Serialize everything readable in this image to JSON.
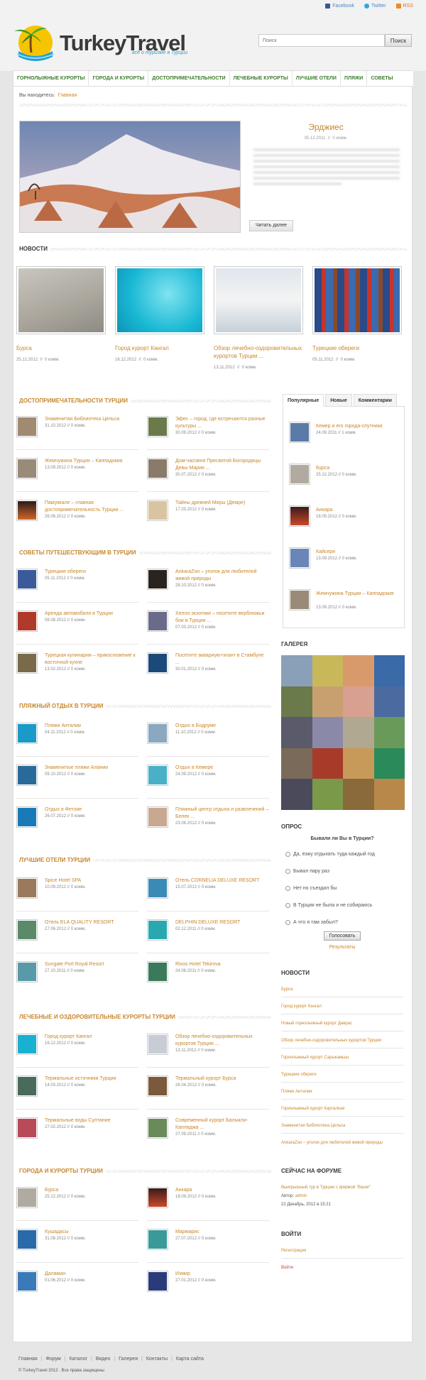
{
  "social": {
    "facebook": "Facebook",
    "twitter": "Twitter",
    "rss": "RSS"
  },
  "logo": {
    "title": "TurkeyTravel",
    "subtitle": "всё о туризме в Турции"
  },
  "search": {
    "placeholder": "Поиск",
    "button": "Поиск"
  },
  "nav": [
    "ГОРНОЛЫЖНЫЕ КУРОРТЫ",
    "ГОРОДА И КУРОРТЫ",
    "ДОСТОПРИМЕЧАТЕЛЬНОСТИ",
    "ЛЕЧЕБНЫЕ КУРОРТЫ",
    "ЛУЧШИЕ ОТЕЛИ",
    "ПЛЯЖИ",
    "СОВЕТЫ"
  ],
  "breadcrumb": {
    "label": "Вы находитесь:",
    "home": "Главная"
  },
  "featured": {
    "title": "Эрджиес",
    "date": "05.12.2011",
    "comments": "0 комм.",
    "button": "Читать далее"
  },
  "news_title": "НОВОСТИ",
  "news": [
    {
      "title": "Бурса",
      "date": "25.12.2012",
      "comments": "0 комм."
    },
    {
      "title": "Город курорт Кангал",
      "date": "16.12.2012",
      "comments": "0 комм."
    },
    {
      "title": "Обзор лечебно-оздоровительных курортов Турции ...",
      "date": "13.11.2012",
      "comments": "0 комм."
    },
    {
      "title": "Турецкие обереги",
      "date": "05.11.2012",
      "comments": "0 комм."
    }
  ],
  "sections": [
    {
      "title": "ДОСТОПРИМЕЧАТЕЛЬНОСТИ ТУРЦИИ",
      "items": [
        {
          "title": "Знаменитая Библиотека Цельса",
          "date": "31.10.2012",
          "comments": "0 комм."
        },
        {
          "title": "Эфес – город, где встречаются разные культуры ...",
          "date": "30.09.2012",
          "comments": "0 комм."
        },
        {
          "title": "Жемчужина Турции – Каппадокия",
          "date": "13.09.2012",
          "comments": "0 комм."
        },
        {
          "title": "Дом-часовня Пресвятой Богородицы Девы Марии ...",
          "date": "30.07.2012",
          "comments": "0 комм."
        },
        {
          "title": "Памуккале – главная достопримечательность Турции ...",
          "date": "26.06.2012",
          "comments": "0 комм."
        },
        {
          "title": "Тайны древней Миры (Демре)",
          "date": "17.03.2012",
          "comments": "0 комм."
        }
      ]
    },
    {
      "title": "СОВЕТЫ ПУТЕШЕСТВУЮЩИМ В ТУРЦИИ",
      "items": [
        {
          "title": "Турецкие обереги",
          "date": "05.11.2012",
          "comments": "0 комм."
        },
        {
          "title": "AnkaraZoo – уголок для любителей живой природы",
          "date": "28.10.2012",
          "comments": "0 комм."
        },
        {
          "title": "Аренда автомобиля в Турции",
          "date": "08.08.2012",
          "comments": "0 комм."
        },
        {
          "title": "Хелло экзотики – посетите верблюжьи бои в Турции ...",
          "date": "07.03.2012",
          "comments": "0 комм."
        },
        {
          "title": "Турецкая кулинария – прикосновение к восточной кухне",
          "date": "13.02.2012",
          "comments": "0 комм."
        },
        {
          "title": "Посетите аквариум-гигант в Стамбуле ...",
          "date": "30.01.2012",
          "comments": "0 комм."
        }
      ]
    },
    {
      "title": "ПЛЯЖНЫЙ ОТДЫХ В ТУРЦИИ",
      "items": [
        {
          "title": "Пляжи Анталии",
          "date": "04.11.2012",
          "comments": "0 комм."
        },
        {
          "title": "Отдых в Бодруме",
          "date": "11.10.2012",
          "comments": "0 комм."
        },
        {
          "title": "Знаменитые пляжи Алании",
          "date": "09.10.2012",
          "comments": "0 комм."
        },
        {
          "title": "Отдых в Кемере",
          "date": "24.09.2012",
          "comments": "0 комм."
        },
        {
          "title": "Отдых в Фетхие",
          "date": "26.07.2012",
          "comments": "0 комм."
        },
        {
          "title": "Пляжный центр отдыха и развлечений – Белек ...",
          "date": "23.06.2012",
          "comments": "0 комм."
        }
      ]
    },
    {
      "title": "ЛУЧШИЕ ОТЕЛИ ТУРЦИИ",
      "items": [
        {
          "title": "Spice Hotel SPA",
          "date": "10.09.2012",
          "comments": "0 комм."
        },
        {
          "title": "Отель CORNELIA DELUXE RESORT",
          "date": "15.07.2012",
          "comments": "0 комм."
        },
        {
          "title": "Отель ELA QUALITY RESORT",
          "date": "27.06.2012",
          "comments": "0 комм."
        },
        {
          "title": "DELPHIN DELUXE RESORT",
          "date": "02.12.2011",
          "comments": "0 комм."
        },
        {
          "title": "Sungate Port Royal Resort",
          "date": "27.10.2011",
          "comments": "0 комм."
        },
        {
          "title": "Rixos Hotel Tekirova",
          "date": "24.08.2011",
          "comments": "0 комм."
        }
      ]
    },
    {
      "title": "ЛЕЧЕБНЫЕ И ОЗДОРОВИТЕЛЬНЫЕ КУРОРТЫ ТУРЦИИ",
      "items": [
        {
          "title": "Город курорт Кангал",
          "date": "16.12.2012",
          "comments": "0 комм."
        },
        {
          "title": "Обзор лечебно-оздоровительных курортов Турции ...",
          "date": "13.11.2012",
          "comments": "0 комм."
        },
        {
          "title": "Термальные источники Турции",
          "date": "14.03.2012",
          "comments": "0 комм."
        },
        {
          "title": "Термальный курорт Бурса",
          "date": "26.04.2012",
          "comments": "0 комм."
        },
        {
          "title": "Термальные воды Султание",
          "date": "27.02.2012",
          "comments": "0 комм."
        },
        {
          "title": "Современный курорт Балыкли-Капладжа ...",
          "date": "27.09.2011",
          "comments": "0 комм."
        }
      ]
    },
    {
      "title": "ГОРОДА И КУРОРТЫ ТУРЦИИ",
      "items": [
        {
          "title": "Бурса",
          "date": "25.12.2012",
          "comments": "0 комм."
        },
        {
          "title": "Анкара",
          "date": "18.09.2012",
          "comments": "0 комм."
        },
        {
          "title": "Кушадасы",
          "date": "31.08.2012",
          "comments": "0 комм."
        },
        {
          "title": "Мармарис",
          "date": "27.07.2012",
          "comments": "0 комм."
        },
        {
          "title": "Даламан",
          "date": "01.06.2012",
          "comments": "0 комм."
        },
        {
          "title": "Измир",
          "date": "27.01.2012",
          "comments": "0 комм."
        }
      ]
    }
  ],
  "tabs": [
    "Популярные",
    "Новые",
    "Комментарии"
  ],
  "popular": [
    {
      "title": "Кемер и его города-спутники",
      "date": "24.09.2011",
      "comments": "1 комм."
    },
    {
      "title": "Бурса",
      "date": "25.12.2012",
      "comments": "0 комм."
    },
    {
      "title": "Анкара",
      "date": "18.09.2012",
      "comments": "0 комм."
    },
    {
      "title": "Кайсери",
      "date": "13.09.2012",
      "comments": "0 комм."
    },
    {
      "title": "Жемчужина Турции – Каппадокия",
      "date": "13.09.2012",
      "comments": "0 комм."
    }
  ],
  "gallery_title": "ГАЛЕРЕЯ",
  "poll": {
    "title": "ОПРОС",
    "question": "Бывали ли Вы в Турции?",
    "options": [
      "Да, езжу отдыхать туда каждый год",
      "Бывал пару раз",
      "Нет но съездил бы",
      "В Турции не была и не собираюсь",
      "А что я там забыл?"
    ],
    "vote": "Голосовать",
    "results": "Результаты"
  },
  "side_news_title": "НОВОСТИ",
  "side_news": [
    "Бурса",
    "Город курорт Кангал",
    "Новый горнолыжный курорт Даврас",
    "Обзор лечебно-оздоровительных курортов Турции",
    "Горнолыжный курорт Сарыкамыш",
    "Турецкие обереги",
    "Пляжи Анталии",
    "Горнолыжный курорт Карталкая",
    "Знаменитая Библиотека Цельса",
    "AnkaraZoo – уголок для любителей живой природы"
  ],
  "forum": {
    "title": "СЕЙЧАС НА ФОРУМЕ",
    "topic": "Выигрышный тур в Турцию с фирмой \"Bauer\"",
    "author_label": "Автор:",
    "author": "admin",
    "date": "22 Декабрь, 2012 в 15:21"
  },
  "login": {
    "title": "ВОЙТИ",
    "register": "Регистрация",
    "login": "Войти"
  },
  "footer": {
    "links": [
      "Главная",
      "Форум",
      "Каталог",
      "Видео",
      "Галерея",
      "Контакты",
      "Карта сайта"
    ],
    "copyright": "© TurkeyTravel 2012 . Все права защищены"
  }
}
